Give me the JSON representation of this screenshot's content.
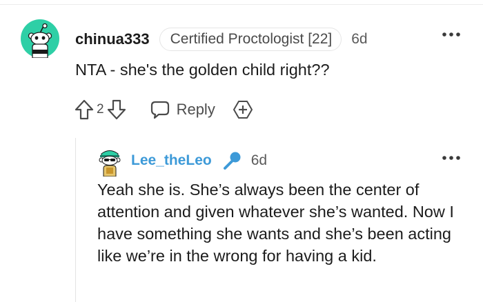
{
  "comment": {
    "username": "chinua333",
    "flair": "Certified Proctologist [22]",
    "time": "6d",
    "body": "NTA - she's the golden child right??",
    "score": "2",
    "reply_label": "Reply",
    "avatar_icon": "snoo-avatar-icon",
    "avatar_color": "#2ecfa6"
  },
  "reply": {
    "username": "Lee_theLeo",
    "username_color": "#3d9ad8",
    "badge_icon": "microphone-icon",
    "time": "6d",
    "body": "Yeah she is. She’s always been the center of attention and given whatever she’s wanted. Now I have something she wants and she’s been acting like we’re in the wrong for having a kid.",
    "avatar_icon": "snoo-avatar-icon"
  }
}
